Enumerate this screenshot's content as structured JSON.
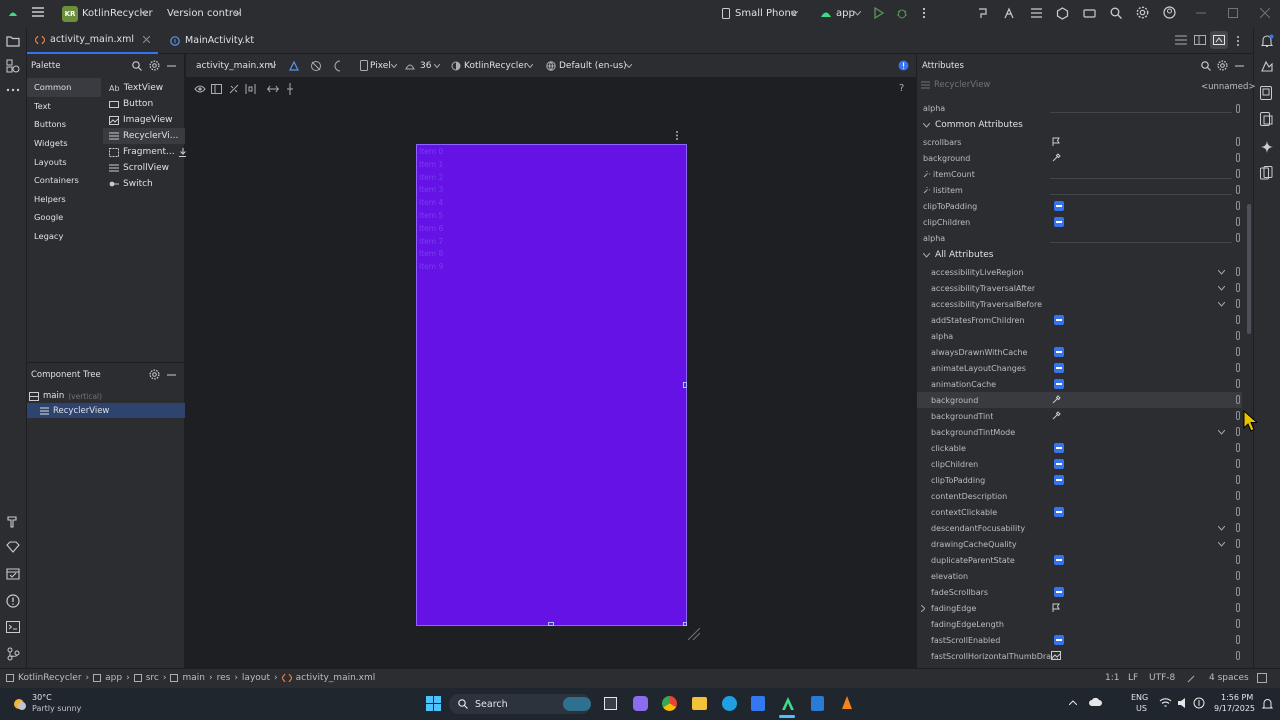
{
  "titlebar": {
    "project_badge": "KR",
    "project_name": "KotlinRecycler",
    "vcs": "Version control",
    "device": "Small Phone",
    "run_config": "app"
  },
  "tabs": [
    {
      "label": "activity_main.xml"
    },
    {
      "label": "MainActivity.kt"
    }
  ],
  "palette": {
    "title": "Palette",
    "categories": [
      "Common",
      "Text",
      "Buttons",
      "Widgets",
      "Layouts",
      "Containers",
      "Helpers",
      "Google",
      "Legacy"
    ],
    "widgets": [
      {
        "icon": "Ab",
        "label": "TextView"
      },
      {
        "icon": "",
        "label": "Button"
      },
      {
        "icon": "",
        "label": "ImageView"
      },
      {
        "icon": "",
        "label": "RecyclerVi..."
      },
      {
        "icon": "",
        "label": "Fragment..."
      },
      {
        "icon": "",
        "label": "ScrollView"
      },
      {
        "icon": "",
        "label": "Switch"
      }
    ]
  },
  "component_tree": {
    "title": "Component Tree",
    "root": "main",
    "root_hint": "(vertical)",
    "child": "RecyclerView"
  },
  "design_toolbar": {
    "file": "activity_main.xml",
    "device": "Pixel",
    "api": "36",
    "theme": "KotlinRecycler",
    "locale": "Default (en-us)"
  },
  "preview": {
    "items": [
      "Item 0",
      "Item 1",
      "Item 2",
      "Item 3",
      "Item 4",
      "Item 5",
      "Item 6",
      "Item 7",
      "Item 8",
      "Item 9"
    ],
    "bg_color": "#6412e6"
  },
  "attributes": {
    "title": "Attributes",
    "component": "RecyclerView",
    "id_hint": "<unnamed>",
    "top_row": "alpha",
    "common_title": "Common Attributes",
    "common": [
      {
        "name": "scrollbars",
        "kind": "flag"
      },
      {
        "name": "background",
        "kind": "picker"
      },
      {
        "name": "itemCount",
        "kind": "field",
        "tool": true
      },
      {
        "name": "listitem",
        "kind": "field",
        "tool": true
      },
      {
        "name": "clipToPadding",
        "kind": "check"
      },
      {
        "name": "clipChildren",
        "kind": "check"
      },
      {
        "name": "alpha",
        "kind": "field"
      }
    ],
    "all_title": "All Attributes",
    "all": [
      {
        "name": "accessibilityLiveRegion",
        "kind": "dropdown"
      },
      {
        "name": "accessibilityTraversalAfter",
        "kind": "dropdown"
      },
      {
        "name": "accessibilityTraversalBefore",
        "kind": "dropdown"
      },
      {
        "name": "addStatesFromChildren",
        "kind": "check"
      },
      {
        "name": "alpha",
        "kind": "none"
      },
      {
        "name": "alwaysDrawnWithCache",
        "kind": "check"
      },
      {
        "name": "animateLayoutChanges",
        "kind": "check"
      },
      {
        "name": "animationCache",
        "kind": "check"
      },
      {
        "name": "background",
        "kind": "picker",
        "hover": true
      },
      {
        "name": "backgroundTint",
        "kind": "picker"
      },
      {
        "name": "backgroundTintMode",
        "kind": "dropdown"
      },
      {
        "name": "clickable",
        "kind": "check"
      },
      {
        "name": "clipChildren",
        "kind": "check"
      },
      {
        "name": "clipToPadding",
        "kind": "check"
      },
      {
        "name": "contentDescription",
        "kind": "none"
      },
      {
        "name": "contextClickable",
        "kind": "check"
      },
      {
        "name": "descendantFocusability",
        "kind": "dropdown"
      },
      {
        "name": "drawingCacheQuality",
        "kind": "dropdown"
      },
      {
        "name": "duplicateParentState",
        "kind": "check"
      },
      {
        "name": "elevation",
        "kind": "none"
      },
      {
        "name": "fadeScrollbars",
        "kind": "check"
      },
      {
        "name": "fadingEdge",
        "kind": "flag",
        "expand": true
      },
      {
        "name": "fadingEdgeLength",
        "kind": "none"
      },
      {
        "name": "fastScrollEnabled",
        "kind": "check"
      },
      {
        "name": "fastScrollHorizontalThumbDra...",
        "kind": "image"
      }
    ]
  },
  "statusbar": {
    "crumbs": [
      "KotlinRecycler",
      "app",
      "src",
      "main",
      "res",
      "layout",
      "activity_main.xml"
    ],
    "pos": "1:1",
    "eol": "LF",
    "enc": "UTF-8",
    "indent": "4 spaces"
  },
  "taskbar": {
    "temp": "30°C",
    "weather": "Partly sunny",
    "search": "Search",
    "lang": "ENG",
    "region": "US",
    "time": "1:56 PM",
    "date": "9/17/2025"
  },
  "colors": {
    "accent": "#3574f0",
    "preview_bg": "#6412e6"
  }
}
